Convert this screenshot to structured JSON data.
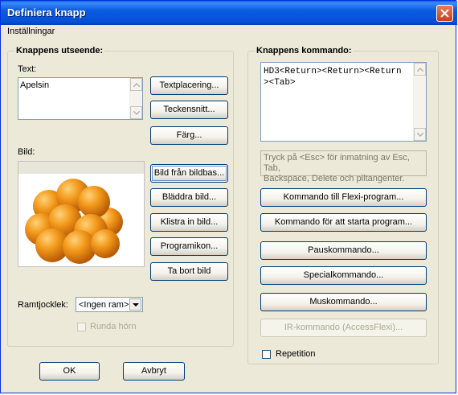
{
  "window": {
    "title": "Definiera knapp"
  },
  "menu": {
    "items": [
      "Inställningar"
    ]
  },
  "left_group": {
    "legend": "Knappens utseende:",
    "text_label": "Text:",
    "text_value": "Apelsin",
    "buttons": {
      "text_placement": "Textplacering...",
      "font": "Teckensnitt...",
      "color": "Färg..."
    },
    "image_label": "Bild:",
    "image_buttons": {
      "from_db": "Bild från bildbas...",
      "browse": "Bläddra bild...",
      "paste": "Klistra in bild...",
      "program_icon": "Programikon...",
      "remove": "Ta bort bild"
    },
    "frame_label": "Ramtjocklek:",
    "frame_value": "<Ingen ram>",
    "round_corners": "Runda hörn"
  },
  "right_group": {
    "legend": "Knappens kommando:",
    "command_text": "HD3<Return><Return><Return><Tab>",
    "command_line1": "HD3<Return><Return><Return",
    "command_line2": "><Tab>",
    "hint": "Tryck på <Esc> för inmatning av Esc, Tab, Backspace, Delete och piltangenter.",
    "hint_line1": "Tryck på <Esc> för inmatning av Esc, Tab,",
    "hint_line2": "Backspace, Delete och piltangenter.",
    "buttons": {
      "flexi": "Kommando till Flexi-program...",
      "start_program": "Kommando för att starta program...",
      "pause": "Pauskommando...",
      "special": "Specialkommando...",
      "mouse": "Muskommando...",
      "ir": "IR-kommando (AccessFlexi)..."
    },
    "repeat_label": "Repetition"
  },
  "footer": {
    "ok": "OK",
    "cancel": "Avbryt"
  },
  "colors": {
    "title_bar": "#0b5ce1",
    "dialog_bg": "#ece9d8",
    "close_button": "#c8401a"
  }
}
